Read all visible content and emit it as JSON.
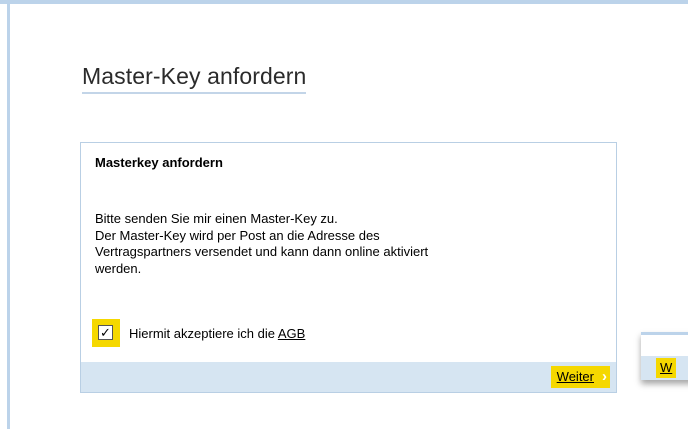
{
  "page": {
    "title": "Master-Key anfordern"
  },
  "card": {
    "heading": "Masterkey anfordern",
    "body_lines": [
      "Bitte senden Sie mir einen Master-Key zu.",
      "Der Master-Key wird per Post an die Adresse des",
      "Vertragspartners versendet und kann dann online aktiviert",
      "werden."
    ],
    "checkbox_mark": "✓",
    "accept_prefix": "Hiermit akzeptiere ich die ",
    "accept_link": "AGB",
    "next_button": "Weiter",
    "next_chevron": "›"
  },
  "popup": {
    "button_fragment": "W"
  },
  "colors": {
    "accent_yellow": "#f5d800",
    "border_blue": "#bcd3ea",
    "footer_blue": "#d6e5f2"
  }
}
